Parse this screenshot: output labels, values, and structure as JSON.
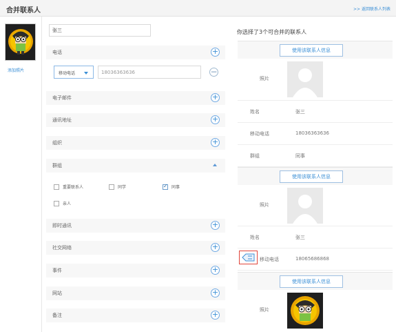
{
  "header": {
    "title": "合并联系人",
    "back_link": ">> 返回联系人列表"
  },
  "left": {
    "add_photo": "添加照片"
  },
  "form": {
    "name_value": "张三",
    "phone_label": "电话",
    "phone_type": "移动电话",
    "phone_value": "18036363636",
    "email_label": "电子邮件",
    "address_label": "通讯地址",
    "org_label": "组织",
    "group_label": "群组",
    "groups": [
      {
        "label": "重要联系人",
        "checked": false
      },
      {
        "label": "同学",
        "checked": false
      },
      {
        "label": "同事",
        "checked": true
      },
      {
        "label": "亲人",
        "checked": false
      }
    ],
    "im_label": "即时通讯",
    "social_label": "社交网络",
    "event_label": "事件",
    "website_label": "网站",
    "note_label": "备注"
  },
  "right": {
    "heading": "你选择了3个可合并的联系人",
    "use_button": "使用该联系人信息",
    "contacts": [
      {
        "photo_label": "照片",
        "name_key": "姓名",
        "name_val": "张三",
        "phone_key": "移动电话",
        "phone_val": "18036363636",
        "group_key": "群组",
        "group_val": "同事"
      },
      {
        "photo_label": "照片",
        "name_key": "姓名",
        "name_val": "张三",
        "phone_key": "移动电话",
        "phone_val": "18065686868"
      },
      {
        "photo_label": "照片"
      }
    ]
  },
  "icons": [
    "plus-icon",
    "minus-icon",
    "chevron-down-icon",
    "caret-up-icon",
    "tag-icon",
    "default-avatar-icon"
  ],
  "colors": {
    "accent": "#3b8fd6",
    "highlight_border": "#e0443a"
  }
}
